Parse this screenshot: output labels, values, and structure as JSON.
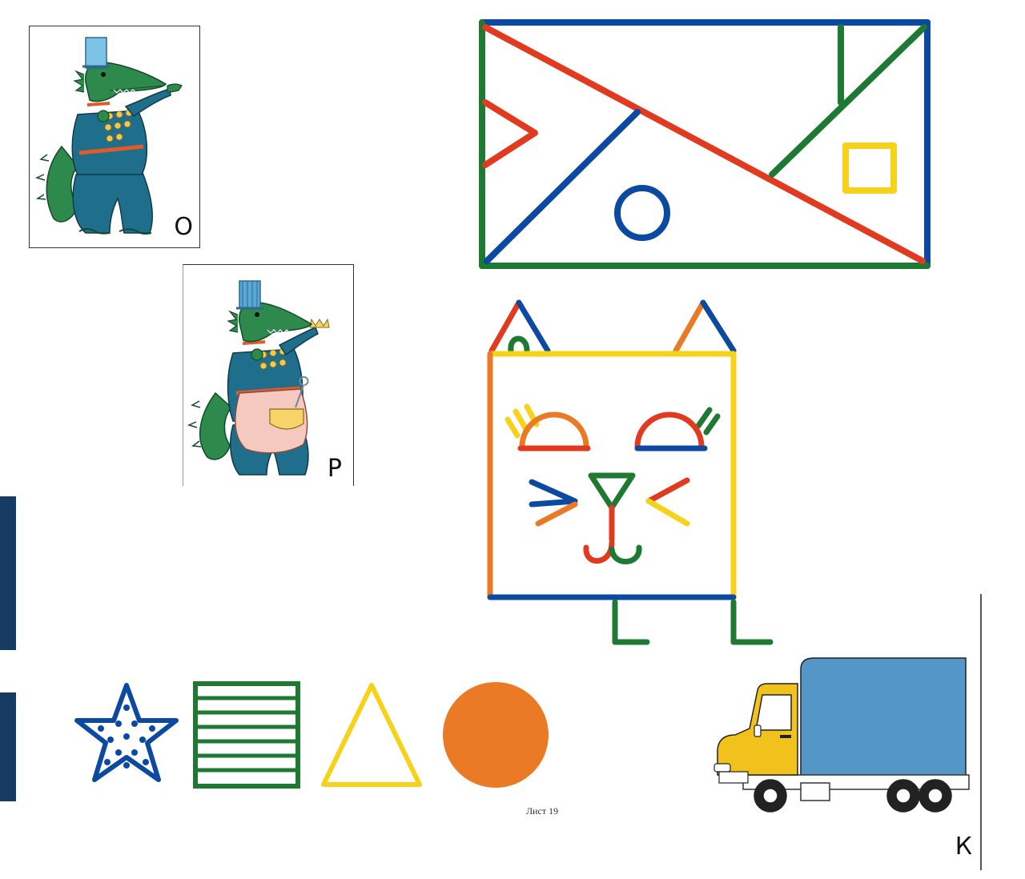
{
  "card_o": {
    "letter": "О",
    "figure": "crocodile-gesturing-icon"
  },
  "card_r": {
    "letter": "Р",
    "figure": "crocodile-with-apron-icon"
  },
  "truck_card": {
    "letter": "К",
    "figure": "truck-icon"
  },
  "sheet_label": "Лист 19",
  "shapes_row": [
    "star-icon",
    "striped-square-icon",
    "triangle-icon",
    "circle-icon"
  ],
  "colors": {
    "blue": "#0b4aa0",
    "red": "#e23a1f",
    "green": "#1e7a32",
    "yellow": "#f7d21a",
    "orange": "#ea7a26",
    "truck_body": "#5596c9",
    "side_bar": "#173c63"
  }
}
